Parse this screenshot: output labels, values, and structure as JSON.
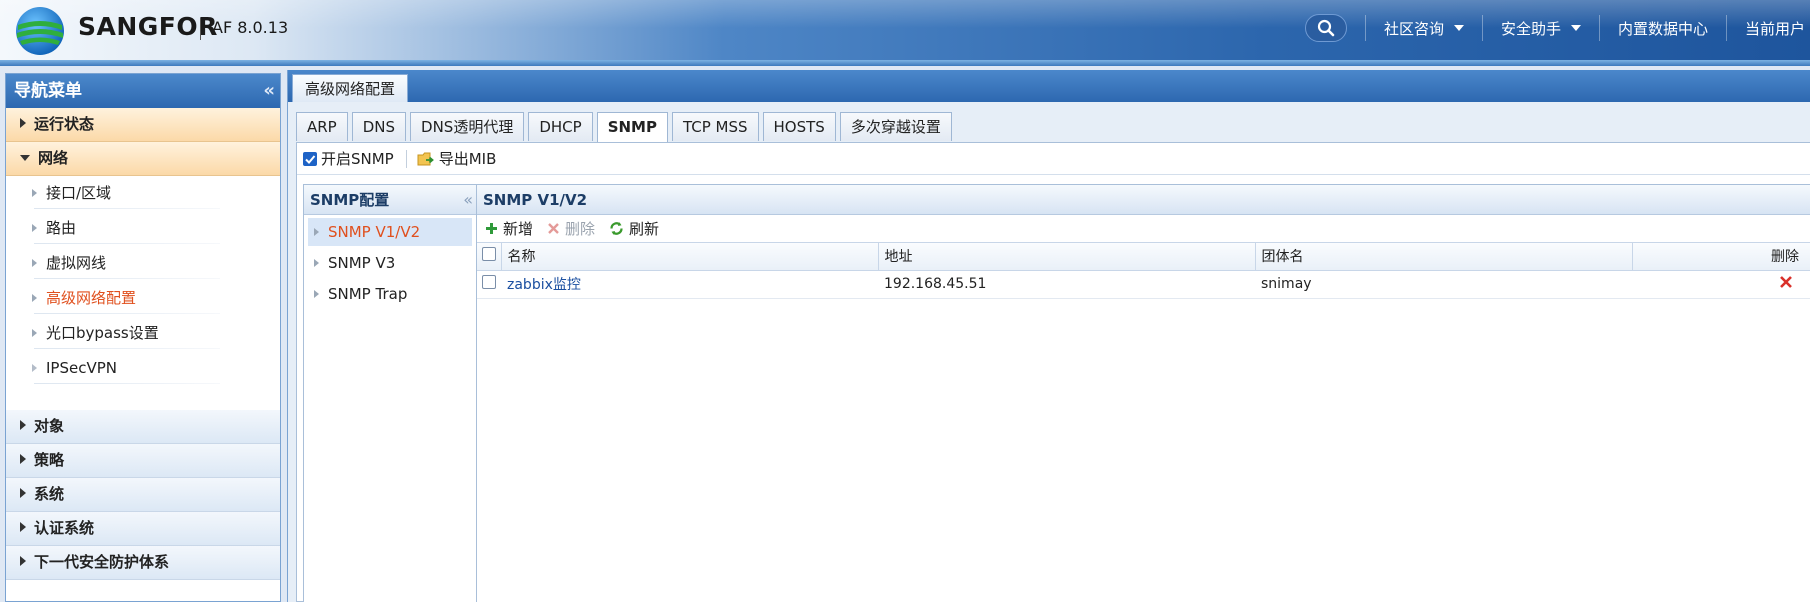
{
  "header": {
    "brand": "SANGFOR",
    "version": "AF 8.0.13",
    "nav": [
      {
        "label": "社区咨询",
        "dropdown": true
      },
      {
        "label": "安全助手",
        "dropdown": true
      },
      {
        "label": "内置数据中心",
        "dropdown": false
      },
      {
        "label": "当前用户",
        "dropdown": false
      }
    ]
  },
  "sidebar": {
    "title": "导航菜单",
    "groups": [
      {
        "label": "运行状态"
      },
      {
        "label": "网络"
      },
      {
        "label": "对象"
      },
      {
        "label": "策略"
      },
      {
        "label": "系统"
      },
      {
        "label": "认证系统"
      },
      {
        "label": "下一代安全防护体系"
      }
    ],
    "network_items": [
      {
        "label": "接口/区域"
      },
      {
        "label": "路由"
      },
      {
        "label": "虚拟网线"
      },
      {
        "label": "高级网络配置"
      },
      {
        "label": "光口bypass设置"
      },
      {
        "label": "IPSecVPN"
      }
    ]
  },
  "main": {
    "tab": "高级网络配置",
    "subtabs": [
      "ARP",
      "DNS",
      "DNS透明代理",
      "DHCP",
      "SNMP",
      "TCP MSS",
      "HOSTS",
      "多次穿越设置"
    ],
    "active_subtab": "SNMP",
    "enable_snmp_label": "开启SNMP",
    "enable_snmp_checked": true,
    "export_mib_label": "导出MIB",
    "tree": {
      "title": "SNMP配置",
      "items": [
        "SNMP V1/V2",
        "SNMP V3",
        "SNMP Trap"
      ]
    },
    "grid": {
      "title": "SNMP V1/V2",
      "tools": {
        "add": "新增",
        "delete": "删除",
        "refresh": "刷新"
      },
      "columns": {
        "name": "名称",
        "address": "地址",
        "community": "团体名",
        "delete": "删除"
      },
      "rows": [
        {
          "name": "zabbix监控",
          "address": "192.168.45.51",
          "community": "snimay"
        }
      ]
    }
  },
  "colors": {
    "accent_blue": "#2d68b0",
    "active_orange": "#e0501e",
    "link_blue": "#1b4fa0",
    "delete_red": "#d9302a"
  }
}
